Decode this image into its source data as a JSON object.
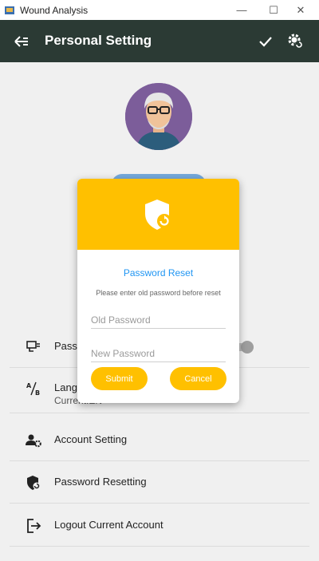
{
  "window": {
    "title": "Wound Analysis",
    "min_glyph": "—",
    "max_glyph": "☐",
    "close_glyph": "✕"
  },
  "appbar": {
    "title": "Personal Setting",
    "back_icon": "back-arrow-icon",
    "confirm_icon": "check-icon",
    "settings_icon": "gear-reset-icon"
  },
  "settings": {
    "items": [
      {
        "label": "Passw",
        "icon": "display-icon"
      },
      {
        "label": "Langu",
        "sub": "Current:EN",
        "icon": "translate-icon"
      },
      {
        "label": "Account Setting",
        "icon": "account-gear-icon"
      },
      {
        "label": "Password Resetting",
        "icon": "shield-reset-icon"
      },
      {
        "label": "Logout Current Account",
        "icon": "logout-icon"
      }
    ]
  },
  "dialog": {
    "title": "Password Reset",
    "hint": "Please enter old password before reset",
    "old_placeholder": "Old Password",
    "new_placeholder": "New Password",
    "submit_label": "Submit",
    "cancel_label": "Cancel",
    "accent": "#ffc000",
    "title_color": "#2196f3"
  },
  "colors": {
    "appbar": "#2b3a34",
    "avatar_bg": "#7c5d9a",
    "background": "#f0f0f0"
  }
}
